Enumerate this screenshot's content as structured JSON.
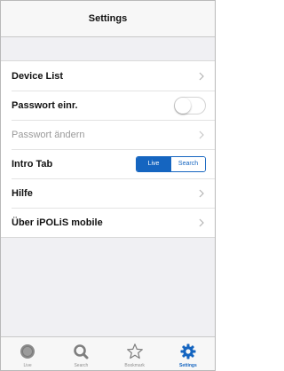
{
  "navbar": {
    "title": "Settings"
  },
  "settings": {
    "rows": [
      {
        "label": "Device List"
      },
      {
        "label": "Passwort einr."
      },
      {
        "label": "Passwort ändern"
      },
      {
        "label": "Intro Tab"
      },
      {
        "label": "Hilfe"
      },
      {
        "label": "Über iPOLiS mobile"
      }
    ],
    "password_toggle_on": false,
    "intro_tab": {
      "options": [
        "Live",
        "Search"
      ],
      "selected": "Live"
    }
  },
  "tabbar": {
    "tabs": [
      {
        "label": "Live",
        "icon": "live-icon"
      },
      {
        "label": "Search",
        "icon": "search-icon"
      },
      {
        "label": "Bookmark",
        "icon": "star-icon"
      },
      {
        "label": "Settings",
        "icon": "gear-icon"
      }
    ],
    "active": "Settings"
  },
  "colors": {
    "accent": "#1565c0",
    "background": "#f0f0f3",
    "disabled_text": "#9a9a9a"
  }
}
